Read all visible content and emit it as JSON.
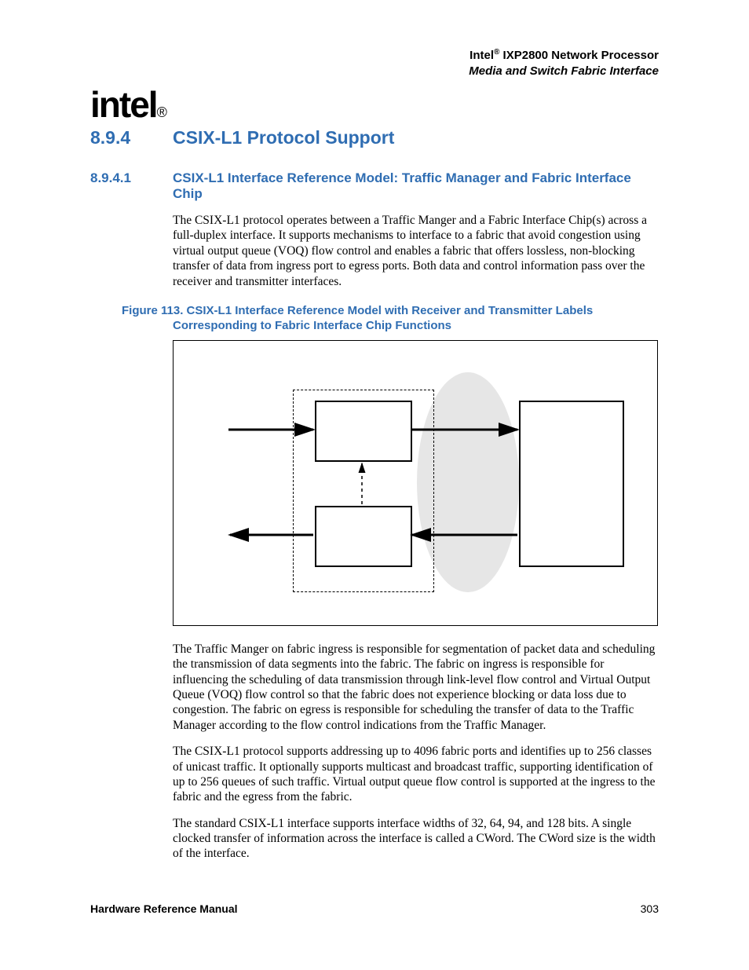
{
  "header": {
    "brand": "Intel",
    "reg": "®",
    "product": " IXP2800 Network Processor",
    "subtitle": "Media and Switch Fabric Interface"
  },
  "logo": {
    "text": "intel",
    "reg": "®"
  },
  "section": {
    "num": "8.9.4",
    "title": "CSIX-L1 Protocol Support"
  },
  "subsection": {
    "num": "8.9.4.1",
    "title": "CSIX-L1 Interface Reference Model: Traffic Manager and Fabric Interface Chip"
  },
  "para1": "The CSIX-L1 protocol operates between a Traffic Manger and a Fabric Interface Chip(s) across a full-duplex interface. It supports mechanisms to interface to a fabric that avoid congestion using virtual output queue (VOQ) flow control and enables a fabric that offers lossless, non-blocking transfer of data from ingress port to egress ports. Both data and control information pass over the receiver and transmitter interfaces.",
  "figure": {
    "label": "Figure 113. CSIX-L1 Interface Reference Model with Receiver and Transmitter Labels",
    "label2": "Corresponding to Fabric Interface Chip Functions"
  },
  "para2": "The Traffic Manger on fabric ingress is responsible for segmentation of packet data and scheduling the transmission of data segments into the fabric. The fabric on ingress is responsible for influencing the scheduling of data transmission through link-level flow control and Virtual Output Queue (VOQ) flow control so that the fabric does not experience blocking or data loss due to congestion. The fabric on egress is responsible for scheduling the transfer of data to the Traffic Manager according to the flow control indications from the Traffic Manager.",
  "para3": "The CSIX-L1 protocol supports addressing up to 4096 fabric ports and identifies up to 256 classes of unicast traffic. It optionally supports multicast and broadcast traffic, supporting identification of up to 256 queues of such traffic. Virtual output queue flow control is supported at the ingress to the fabric and the egress from the fabric.",
  "para4": "The standard CSIX-L1 interface supports interface widths of 32, 64, 94, and 128 bits. A single clocked transfer of information across the interface is called a CWord. The CWord size is the width of the interface.",
  "footer": {
    "left": "Hardware Reference Manual",
    "right": "303"
  }
}
